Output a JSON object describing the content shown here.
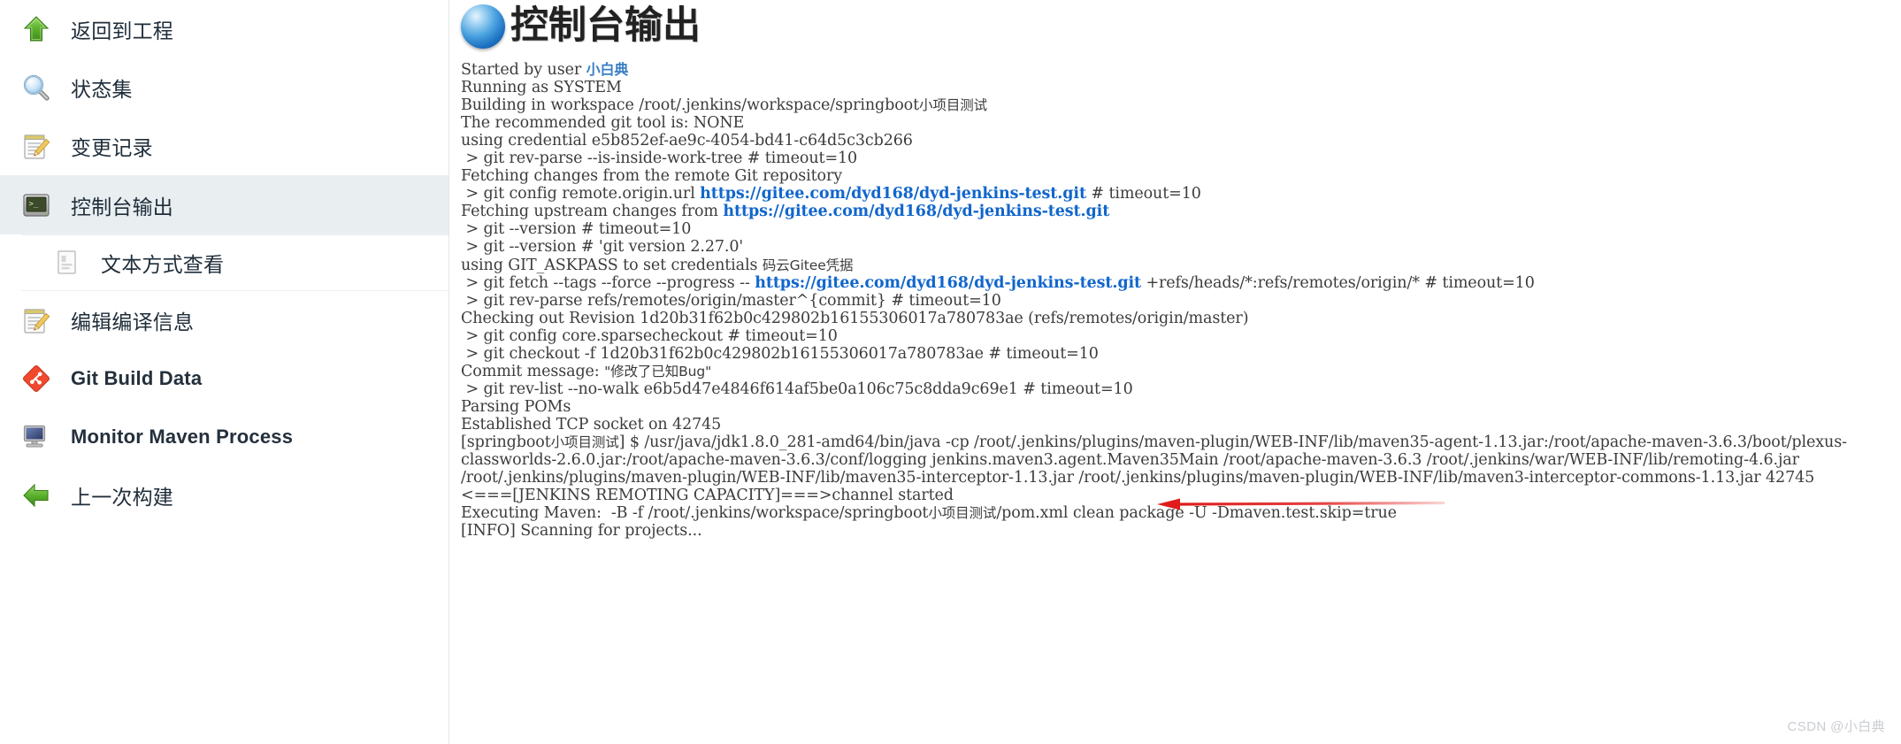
{
  "sidebar": {
    "items": [
      {
        "label": "返回到工程",
        "icon": "up-arrow-green-icon",
        "name": "sidebar-item-back-to-project",
        "type": "main"
      },
      {
        "label": "状态集",
        "icon": "magnifier-icon",
        "name": "sidebar-item-status",
        "type": "main"
      },
      {
        "label": "变更记录",
        "icon": "notepad-pencil-icon",
        "name": "sidebar-item-changes",
        "type": "main"
      },
      {
        "label": "控制台输出",
        "icon": "terminal-icon",
        "name": "sidebar-item-console-output",
        "type": "main",
        "selected": true
      },
      {
        "label": "文本方式查看",
        "icon": "document-page-icon",
        "name": "sidebar-item-view-as-plain-text",
        "type": "sub"
      },
      {
        "label": "编辑编译信息",
        "icon": "notepad-pencil-icon",
        "name": "sidebar-item-edit-build-information",
        "type": "main"
      },
      {
        "label": "Git Build Data",
        "icon": "git-diamond-icon",
        "name": "sidebar-item-git-build-data",
        "type": "main",
        "latin": true
      },
      {
        "label": "Monitor Maven Process",
        "icon": "monitor-icon",
        "name": "sidebar-item-monitor-maven-process",
        "type": "main",
        "latin": true
      },
      {
        "label": "上一次构建",
        "icon": "left-arrow-green-icon",
        "name": "sidebar-item-previous-build",
        "type": "main"
      }
    ]
  },
  "header": {
    "title": "控制台输出",
    "icon": "blue-ball-icon"
  },
  "console": {
    "lines": [
      {
        "segments": [
          {
            "t": "Started by user "
          },
          {
            "t": "小白典",
            "s": "usr"
          }
        ]
      },
      {
        "segments": [
          {
            "t": "Running as SYSTEM"
          }
        ]
      },
      {
        "segments": [
          {
            "t": "Building in workspace /root/.jenkins/workspace/springboot"
          },
          {
            "t": "小项目测试",
            "s": "zh"
          }
        ]
      },
      {
        "segments": [
          {
            "t": "The recommended git tool is: NONE"
          }
        ]
      },
      {
        "segments": [
          {
            "t": "using credential e5b852ef-ae9c-4054-bd41-c64d5c3cb266"
          }
        ]
      },
      {
        "segments": [
          {
            "t": " > git rev-parse --is-inside-work-tree # timeout=10"
          }
        ]
      },
      {
        "segments": [
          {
            "t": "Fetching changes from the remote Git repository"
          }
        ]
      },
      {
        "segments": [
          {
            "t": " > git config remote.origin.url "
          },
          {
            "t": "https://gitee.com/dyd168/dyd-jenkins-test.git",
            "s": "lnk"
          },
          {
            "t": " # timeout=10"
          }
        ]
      },
      {
        "segments": [
          {
            "t": "Fetching upstream changes from "
          },
          {
            "t": "https://gitee.com/dyd168/dyd-jenkins-test.git",
            "s": "lnk"
          }
        ]
      },
      {
        "segments": [
          {
            "t": " > git --version # timeout=10"
          }
        ]
      },
      {
        "segments": [
          {
            "t": " > git --version # 'git version 2.27.0'"
          }
        ]
      },
      {
        "segments": [
          {
            "t": "using GIT_ASKPASS to set credentials "
          },
          {
            "t": "码云Gitee凭据",
            "s": "zh"
          }
        ]
      },
      {
        "segments": [
          {
            "t": " > git fetch --tags --force --progress -- "
          },
          {
            "t": "https://gitee.com/dyd168/dyd-jenkins-test.git",
            "s": "lnk"
          },
          {
            "t": " +refs/heads/*:refs/remotes/origin/* # timeout=10"
          }
        ]
      },
      {
        "segments": [
          {
            "t": " > git rev-parse refs/remotes/origin/master^{commit} # timeout=10"
          }
        ]
      },
      {
        "segments": [
          {
            "t": "Checking out Revision 1d20b31f62b0c429802b16155306017a780783ae (refs/remotes/origin/master)"
          }
        ]
      },
      {
        "segments": [
          {
            "t": " > git config core.sparsecheckout # timeout=10"
          }
        ]
      },
      {
        "segments": [
          {
            "t": " > git checkout -f 1d20b31f62b0c429802b16155306017a780783ae # timeout=10"
          }
        ]
      },
      {
        "segments": [
          {
            "t": "Commit message: "
          },
          {
            "t": "\"修改了已知Bug\"",
            "s": "zh"
          }
        ]
      },
      {
        "segments": [
          {
            "t": " > git rev-list --no-walk e6b5d47e4846f614af5be0a106c75c8dda9c69e1 # timeout=10"
          }
        ]
      },
      {
        "segments": [
          {
            "t": "Parsing POMs"
          }
        ]
      },
      {
        "segments": [
          {
            "t": "Established TCP socket on 42745"
          }
        ]
      },
      {
        "segments": [
          {
            "t": "[springboot"
          },
          {
            "t": "小项目测试",
            "s": "zh"
          },
          {
            "t": "] $ /usr/java/jdk1.8.0_281-amd64/bin/java -cp /root/.jenkins/plugins/maven-plugin/WEB-INF/lib/maven35-agent-1.13.jar:/root/apache-maven-3.6.3/boot/plexus-"
          }
        ]
      },
      {
        "segments": [
          {
            "t": "classworlds-2.6.0.jar:/root/apache-maven-3.6.3/conf/logging jenkins.maven3.agent.Maven35Main /root/apache-maven-3.6.3 /root/.jenkins/war/WEB-INF/lib/remoting-4.6.jar"
          }
        ]
      },
      {
        "segments": [
          {
            "t": "/root/.jenkins/plugins/maven-plugin/WEB-INF/lib/maven35-interceptor-1.13.jar /root/.jenkins/plugins/maven-plugin/WEB-INF/lib/maven3-interceptor-commons-1.13.jar 42745"
          }
        ]
      },
      {
        "segments": [
          {
            "t": "<===[JENKINS REMOTING CAPACITY]===>channel started"
          }
        ]
      },
      {
        "segments": [
          {
            "t": "Executing Maven:  -B -f /root/.jenkins/workspace/springboot"
          },
          {
            "t": "小项目测试",
            "s": "zh"
          },
          {
            "t": "/pom.xml clean package -U -Dmaven.test.skip=true"
          }
        ]
      },
      {
        "segments": [
          {
            "t": "[INFO] Scanning for projects..."
          }
        ]
      }
    ]
  },
  "annotation": {
    "arrow_color": "#e01b1b",
    "name": "red-arrow-pointing-to-commit-message"
  },
  "watermark": {
    "text": "CSDN @小白典"
  },
  "colors": {
    "selected_row": "#e9eef1",
    "link": "#1166cc",
    "console_text": "#3c3c3c",
    "accent_red": "#e01b1b"
  }
}
